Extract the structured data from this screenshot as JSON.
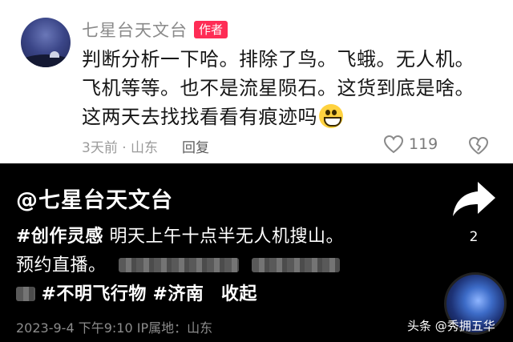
{
  "comment": {
    "author": "七星台天文台",
    "author_tag": "作者",
    "text": "判断分析一下哈。排除了鸟。飞蛾。无人机。飞机等等。也不是流星陨石。这货到底是啥。这两天去找找看看有痕迹吗",
    "meta": "3天前 · 山东",
    "reply_label": "回复",
    "like_count": "119"
  },
  "post": {
    "handle": "@七星台天文台",
    "hashtag_1": "#创作灵感",
    "caption_1": "明天上午十点半无人机搜山。",
    "caption_2": "预约直播。",
    "hashtag_2": "#不明飞行物",
    "hashtag_3": "#济南",
    "collapse_label": "收起",
    "timestamp": "2023-9-4 下午9:10 IP属地：山东",
    "share_count": "2"
  },
  "watermark": "头条 @秀拥五华",
  "colors": {
    "author_tag_bg": "#fe2c55",
    "emoji": "#ffd23f"
  }
}
